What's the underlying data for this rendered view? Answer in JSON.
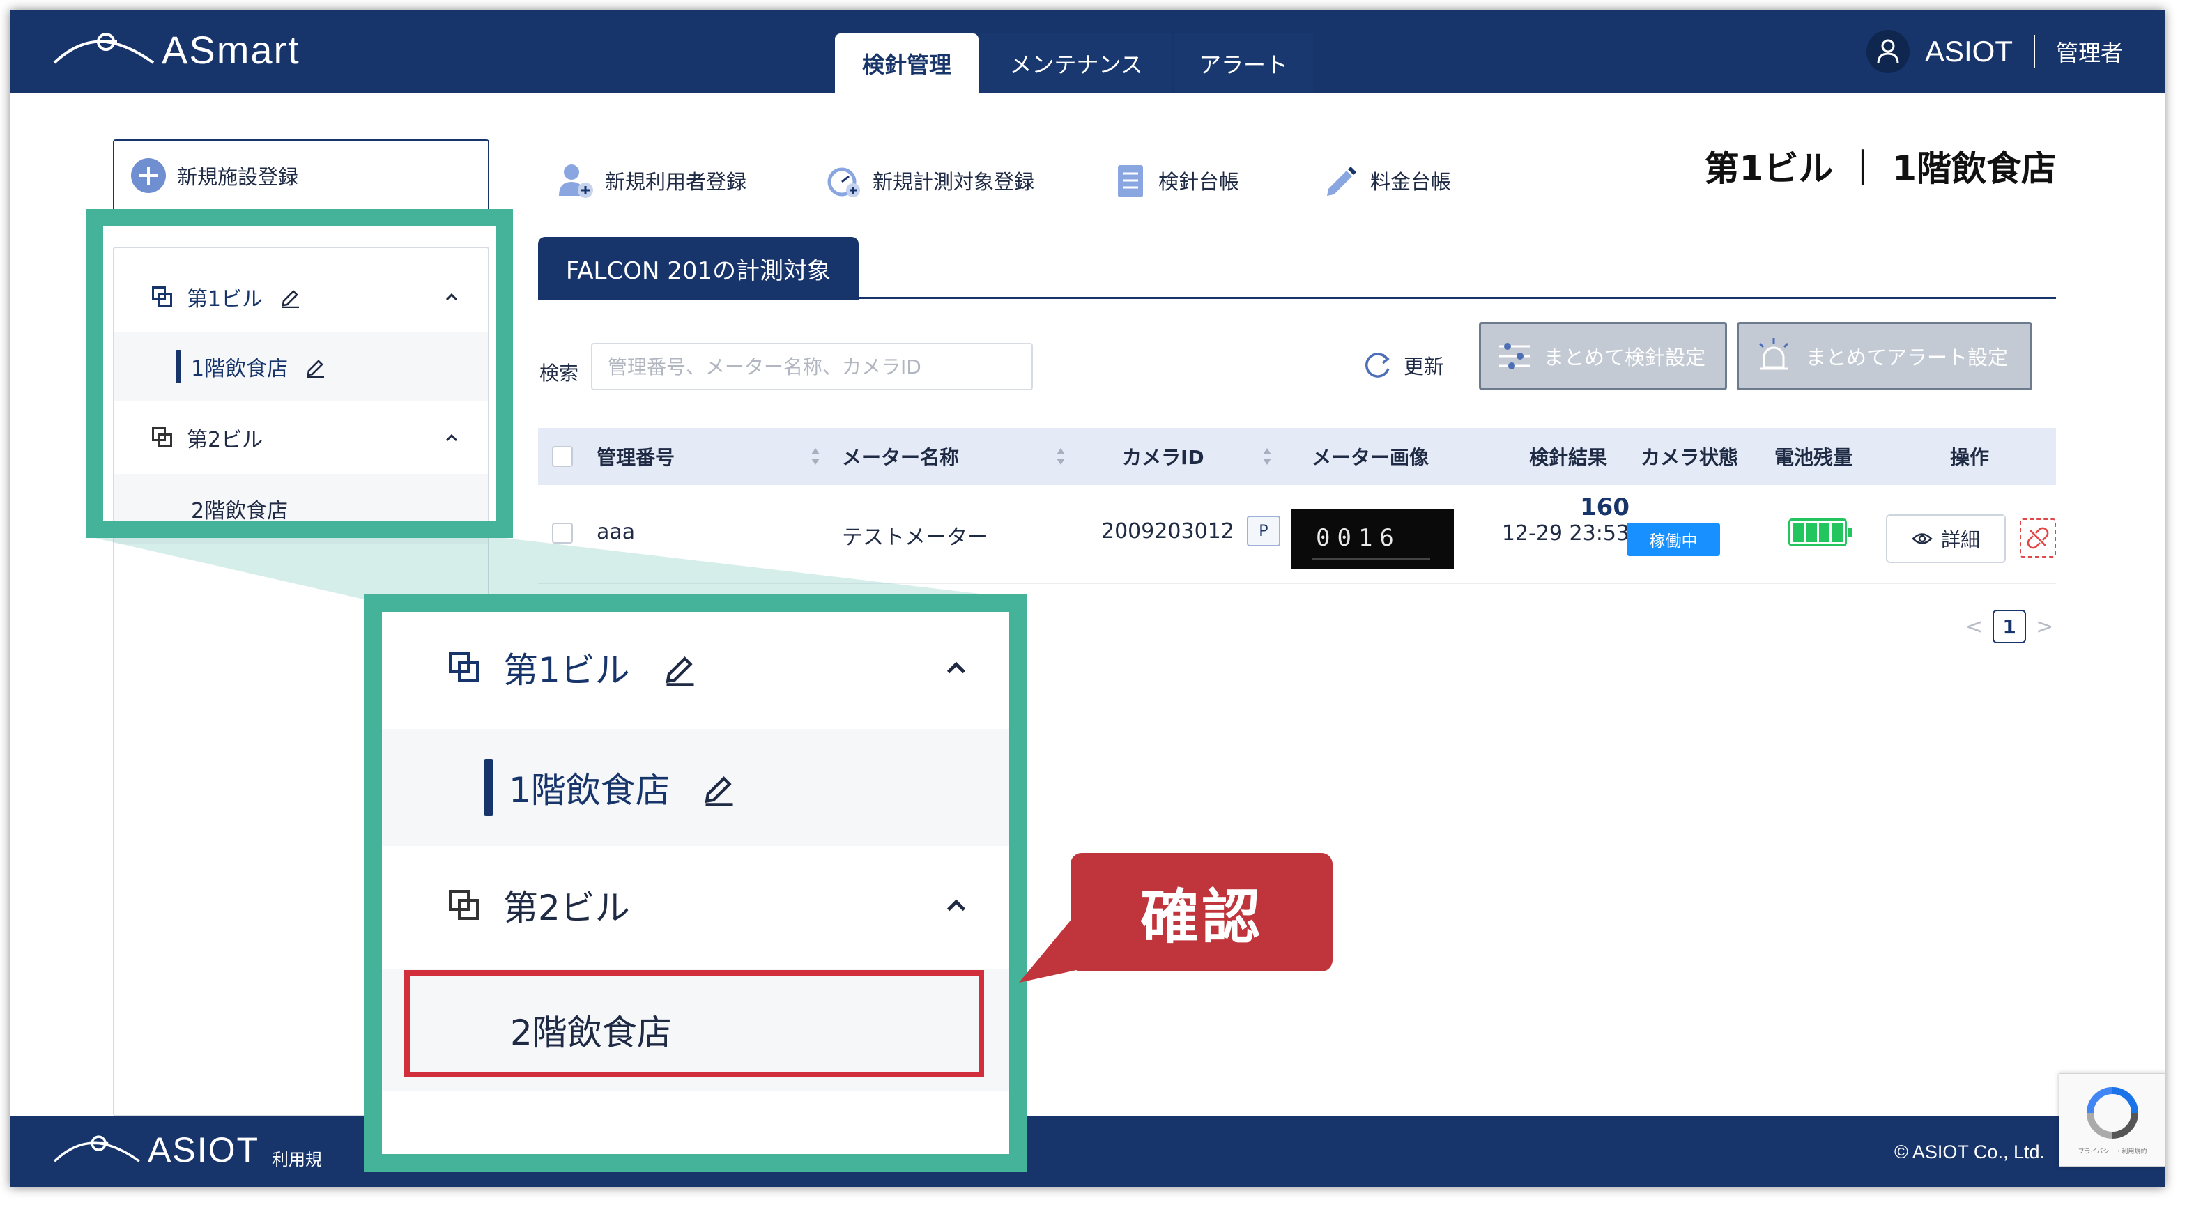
{
  "app": {
    "logo_text": "ASmart",
    "tabs": [
      {
        "label": "検針管理",
        "active": true
      },
      {
        "label": "メンテナンス",
        "active": false
      },
      {
        "label": "アラート",
        "active": false
      }
    ],
    "user_name": "ASIOT",
    "user_role": "管理者"
  },
  "sidebar": {
    "add_facility_label": "新規施設登録",
    "tree": [
      {
        "label": "第1ビル",
        "expanded": true,
        "children": [
          {
            "label": "1階飲食店",
            "selected": true
          }
        ]
      },
      {
        "label": "第2ビル",
        "expanded": true,
        "children": [
          {
            "label": "2階飲食店",
            "selected": false
          }
        ]
      }
    ]
  },
  "toolbar": {
    "items": [
      {
        "label": "新規利用者登録",
        "icon": "add-user-icon"
      },
      {
        "label": "新規計測対象登録",
        "icon": "add-meter-icon"
      },
      {
        "label": "検針台帳",
        "icon": "ledger-icon"
      },
      {
        "label": "料金台帳",
        "icon": "pencil-icon"
      }
    ]
  },
  "location_title": "第1ビル ｜ 1階飲食店",
  "subtab_label": "FALCON 201の計測対象",
  "search": {
    "label": "検索",
    "placeholder": "管理番号、メーター名称、カメラID"
  },
  "refresh_label": "更新",
  "bulk_reading_label": "まとめて検針設定",
  "bulk_alert_label": "まとめてアラート設定",
  "table": {
    "headers": [
      "管理番号",
      "メーター名称",
      "カメラID",
      "メーター画像",
      "検針結果",
      "カメラ状態",
      "電池残量",
      "操作"
    ],
    "rows": [
      {
        "mgmt_no": "aaa",
        "meter_name": "テストメーター",
        "camera_id": "2009203012",
        "camera_badge": "P",
        "meter_image_text": "0016",
        "reading_value": "160",
        "reading_time": "12-29 23:53",
        "camera_status": "稼働中",
        "battery_level": 1.0,
        "detail_label": "詳細"
      }
    ]
  },
  "pagination": {
    "current": "1",
    "prev": "<",
    "next": ">"
  },
  "footer": {
    "logo_text": "ASIOT",
    "links_text": "利用規",
    "copyright": "© ASIOT Co., Ltd."
  },
  "recaptcha_text": "プライバシー・利用規約",
  "zoom": {
    "building1": "第1ビル",
    "floor1": "1階飲食店",
    "building2": "第2ビル",
    "floor2": "2階飲食店"
  },
  "callout_label": "確認",
  "colors": {
    "brand": "#17356b",
    "highlight": "#44b399",
    "callout": "#c0353b",
    "status": "#1890ff",
    "battery": "#22c55e"
  }
}
